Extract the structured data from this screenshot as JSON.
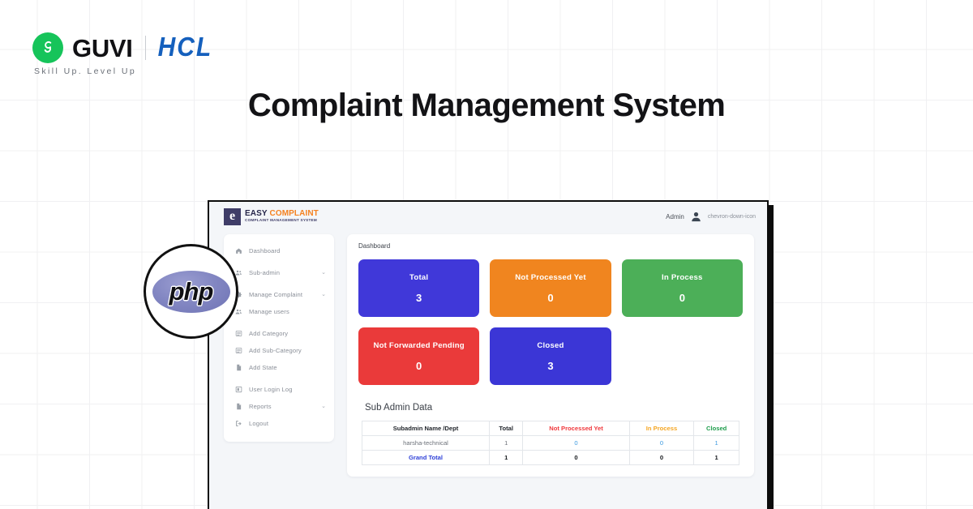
{
  "poster": {
    "headline": "Complaint Management System",
    "brand": {
      "guvi_name": "GUVI",
      "guvi_tagline": "Skill Up. Level Up",
      "partner_name": "HCL",
      "guvi_mark_icon": "guvi-g-icon",
      "separator_icon": "vertical-divider-icon"
    },
    "tech_badge": {
      "label": "php",
      "icon": "php-logo-icon"
    }
  },
  "app": {
    "logo": {
      "glyph": "e",
      "title_part1": "EASY",
      "title_part2": "COMPLAINT",
      "subtitle": "COMPLAINT MANAGEMENT SYSTEM"
    },
    "topbar": {
      "admin_label": "Admin",
      "avatar_icon": "user-avatar-icon",
      "caret_icon": "chevron-down-icon"
    },
    "sidebar": {
      "items": [
        {
          "label": "Dashboard",
          "icon": "home-icon",
          "chevron": "",
          "gap_after": true
        },
        {
          "label": "Sub-admin",
          "icon": "users-icon",
          "chevron": "⌄",
          "gap_after": true
        },
        {
          "label": "Manage Complaint",
          "icon": "gear-icon",
          "chevron": "⌄",
          "gap_after": false
        },
        {
          "label": "Manage users",
          "icon": "users-icon",
          "chevron": "",
          "gap_after": true
        },
        {
          "label": "Add Category",
          "icon": "list-icon",
          "chevron": "",
          "gap_after": false
        },
        {
          "label": "Add Sub-Category",
          "icon": "list-icon",
          "chevron": "",
          "gap_after": false
        },
        {
          "label": "Add State",
          "icon": "file-icon",
          "chevron": "",
          "gap_after": true
        },
        {
          "label": "User Login Log",
          "icon": "log-icon",
          "chevron": "",
          "gap_after": false
        },
        {
          "label": "Reports",
          "icon": "file-icon",
          "chevron": "⌄",
          "gap_after": false
        },
        {
          "label": "Logout",
          "icon": "logout-icon",
          "chevron": "",
          "gap_after": false
        }
      ]
    },
    "dashboard": {
      "heading": "Dashboard",
      "stats": [
        {
          "title": "Total",
          "value": "3",
          "color": "#4038d9"
        },
        {
          "title": "Not Processed Yet",
          "value": "0",
          "color": "#f0851f"
        },
        {
          "title": "In Process",
          "value": "0",
          "color": "#4caf58"
        },
        {
          "title": "Not Forwarded Pending",
          "value": "0",
          "color": "#ea3a3a"
        },
        {
          "title": "Closed",
          "value": "3",
          "color": "#3b36d6"
        }
      ],
      "subadmin": {
        "title": "Sub Admin Data",
        "columns": [
          {
            "label": "Subadmin Name /Dept",
            "color_class": ""
          },
          {
            "label": "Total",
            "color_class": ""
          },
          {
            "label": "Not Processed Yet",
            "color_class": "c-red"
          },
          {
            "label": "In Process",
            "color_class": "c-amber"
          },
          {
            "label": "Closed",
            "color_class": "c-green"
          }
        ],
        "rows": [
          {
            "name": "harsha-technical",
            "total": "1",
            "not_processed": "0",
            "in_process": "0",
            "closed": "1"
          }
        ],
        "grand_total": {
          "name": "Grand Total",
          "total": "1",
          "not_processed": "0",
          "in_process": "0",
          "closed": "1"
        }
      }
    }
  }
}
